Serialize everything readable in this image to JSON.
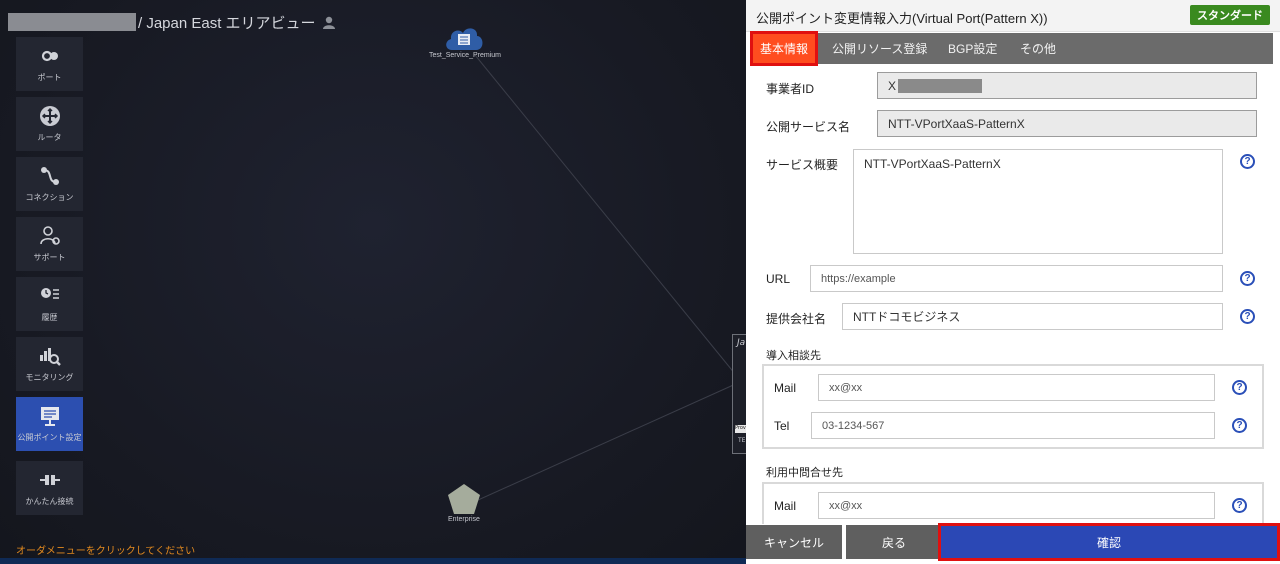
{
  "map": {
    "area_title": "/ Japan East エリアビュー",
    "hint": "オーダメニューをクリックしてください",
    "nodes": {
      "service": "Test_Service_Premium",
      "enterprise": "Enterprise",
      "partial_title": "Ja",
      "partial_tag": "Prov",
      "partial_sub": "TE"
    }
  },
  "sidebar": {
    "items": [
      {
        "label": "ポート",
        "icon": "port-icon"
      },
      {
        "label": "ルータ",
        "icon": "router-icon"
      },
      {
        "label": "コネクション",
        "icon": "connection-icon"
      },
      {
        "label": "サポート",
        "icon": "support-icon"
      },
      {
        "label": "履歴",
        "icon": "history-icon"
      },
      {
        "label": "モニタリング",
        "icon": "monitoring-icon"
      },
      {
        "label": "公開ポイント設定",
        "icon": "publish-point-icon"
      },
      {
        "label": "かんたん接続",
        "icon": "easy-connect-icon"
      }
    ],
    "active_index": 6
  },
  "panel": {
    "title": "公開ポイント変更情報入力(Virtual Port(Pattern X))",
    "badge": "スタンダード",
    "tabs": [
      "基本情報",
      "公開リソース登録",
      "BGP設定",
      "その他"
    ],
    "active_tab": 0,
    "fields": {
      "operator_id": {
        "label": "事業者ID",
        "value": "X"
      },
      "service_name": {
        "label": "公開サービス名",
        "value": "NTT-VPortXaaS-PatternX"
      },
      "service_summary": {
        "label": "サービス概要",
        "value": "NTT-VPortXaaS-PatternX"
      },
      "url": {
        "label": "URL",
        "value": "https://example"
      },
      "provider": {
        "label": "提供会社名",
        "value": "NTTドコモビジネス"
      },
      "intro_contact": {
        "label": "導入相談先",
        "mail_label": "Mail",
        "mail_value": "xx@xx",
        "tel_label": "Tel",
        "tel_value": "03-1234-567"
      },
      "inquiry_contact": {
        "label": "利用中問合せ先",
        "mail_label": "Mail",
        "mail_value": "xx@xx"
      }
    },
    "help_glyph": "?",
    "footer": {
      "cancel": "キャンセル",
      "back": "戻る",
      "confirm": "確認"
    }
  },
  "colors": {
    "active_tab": "#ff4d1f",
    "confirm_button": "#2b48b5",
    "highlight_border": "#e01010",
    "badge": "#3a8a1f",
    "sidebar_active": "#2c4fb0",
    "hint_text": "#e38a1f"
  }
}
